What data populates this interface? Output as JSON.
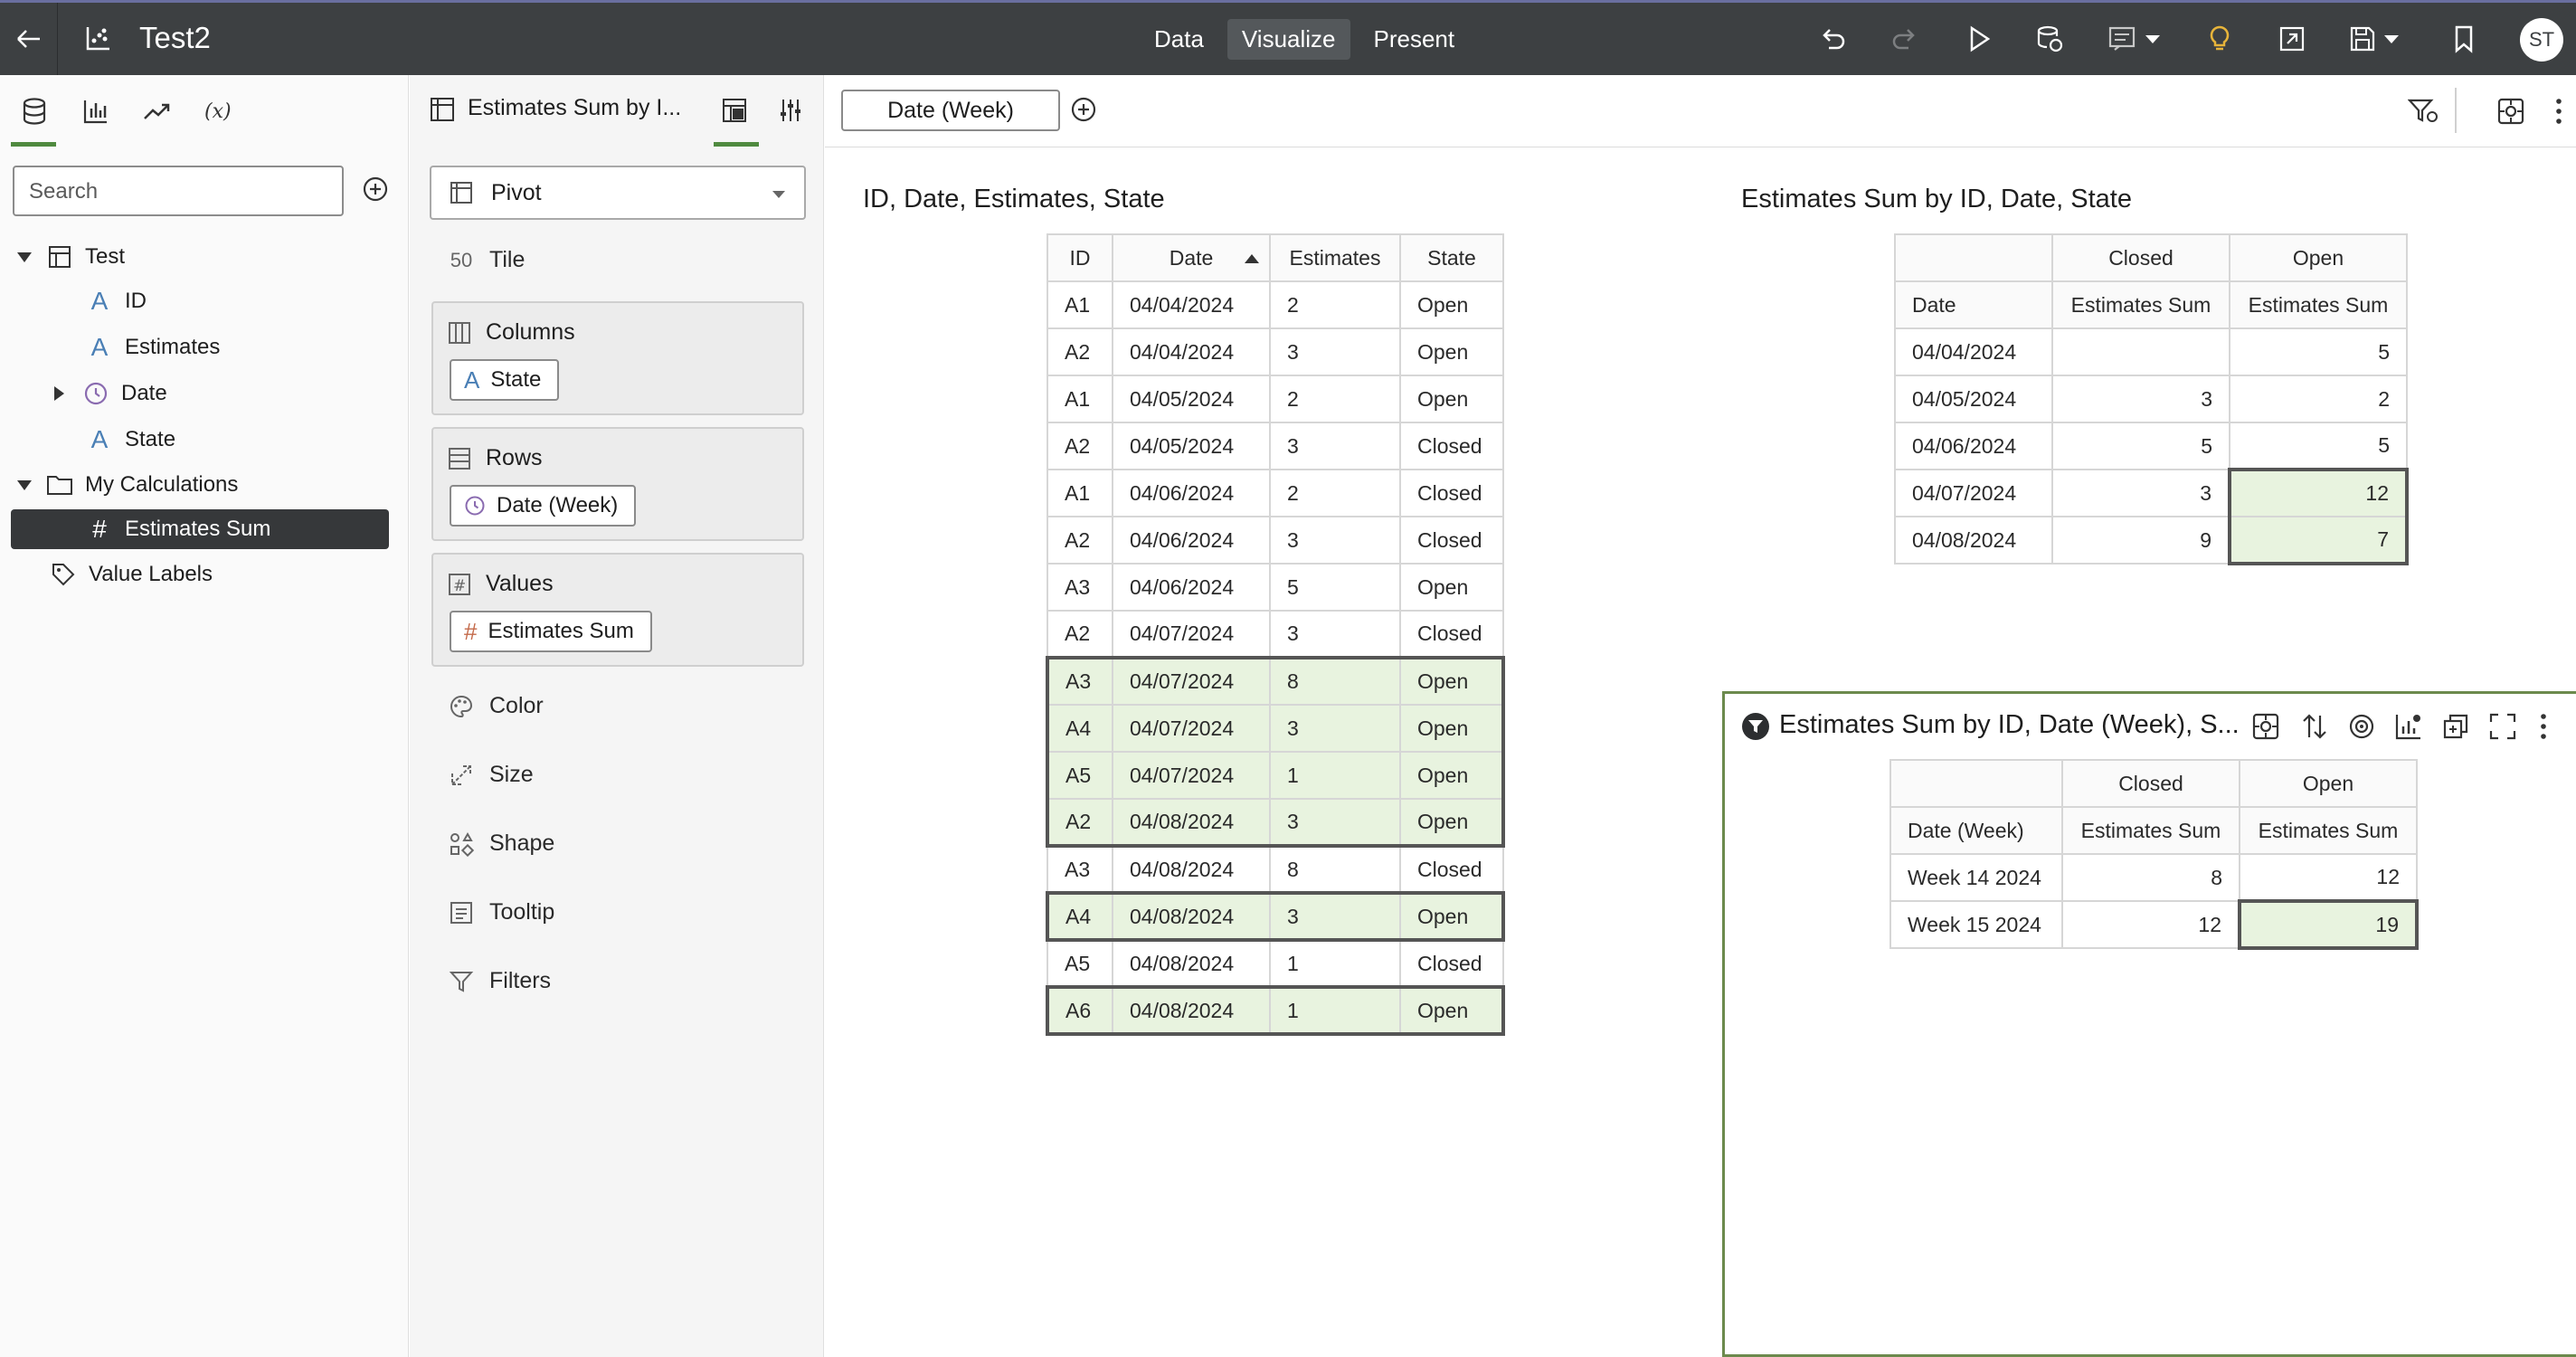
{
  "app": {
    "title": "Test2",
    "mode_tabs": [
      "Data",
      "Visualize",
      "Present"
    ],
    "active_mode": "Visualize",
    "user_initials": "ST",
    "icons": [
      "back-arrow-icon",
      "workbook-icon",
      "undo-icon",
      "redo-icon",
      "run-icon",
      "refresh-data-icon",
      "comment-icon",
      "insights-bulb-icon",
      "export-icon",
      "save-icon",
      "bookmark-icon"
    ]
  },
  "data_panel": {
    "tabs": [
      "data-icon",
      "visualizations-icon",
      "analytics-icon",
      "expression-icon"
    ],
    "search_placeholder": "Search",
    "tree": {
      "dataset": "Test",
      "fields": [
        "ID",
        "Estimates",
        "Date",
        "State"
      ],
      "calculations_folder": "My Calculations",
      "calculation": "Estimates Sum",
      "value_labels": "Value Labels"
    }
  },
  "grammar_panel": {
    "viz_name": "Estimates Sum by I...",
    "viz_type": "Pivot",
    "tile_label": "Tile",
    "columns": {
      "label": "Columns",
      "pill": "State"
    },
    "rows": {
      "label": "Rows",
      "pill": "Date (Week)"
    },
    "values": {
      "label": "Values",
      "pill": "Estimates Sum"
    },
    "properties": [
      "Color",
      "Size",
      "Shape",
      "Tooltip",
      "Filters"
    ]
  },
  "canvas": {
    "filter_chip": "Date (Week)",
    "viz1": {
      "title": "ID, Date, Estimates, State",
      "headers": [
        "ID",
        "Date",
        "Estimates",
        "State"
      ],
      "rows": [
        [
          "A1",
          "04/04/2024",
          "2",
          "Open"
        ],
        [
          "A2",
          "04/04/2024",
          "3",
          "Open"
        ],
        [
          "A1",
          "04/05/2024",
          "2",
          "Open"
        ],
        [
          "A2",
          "04/05/2024",
          "3",
          "Closed"
        ],
        [
          "A1",
          "04/06/2024",
          "2",
          "Closed"
        ],
        [
          "A2",
          "04/06/2024",
          "3",
          "Closed"
        ],
        [
          "A3",
          "04/06/2024",
          "5",
          "Open"
        ],
        [
          "A2",
          "04/07/2024",
          "3",
          "Closed"
        ],
        [
          "A3",
          "04/07/2024",
          "8",
          "Open"
        ],
        [
          "A4",
          "04/07/2024",
          "3",
          "Open"
        ],
        [
          "A5",
          "04/07/2024",
          "1",
          "Open"
        ],
        [
          "A2",
          "04/08/2024",
          "3",
          "Open"
        ],
        [
          "A3",
          "04/08/2024",
          "8",
          "Closed"
        ],
        [
          "A4",
          "04/08/2024",
          "3",
          "Open"
        ],
        [
          "A5",
          "04/08/2024",
          "1",
          "Closed"
        ],
        [
          "A6",
          "04/08/2024",
          "1",
          "Open"
        ]
      ]
    },
    "viz2": {
      "title": "Estimates Sum by ID, Date, State",
      "col_headers": [
        "Closed",
        "Open"
      ],
      "row_header": "Date",
      "measure": "Estimates Sum",
      "rows": [
        [
          "04/04/2024",
          "",
          "5"
        ],
        [
          "04/05/2024",
          "3",
          "2"
        ],
        [
          "04/06/2024",
          "5",
          "5"
        ],
        [
          "04/07/2024",
          "3",
          "12"
        ],
        [
          "04/08/2024",
          "9",
          "7"
        ]
      ]
    },
    "viz3": {
      "title": "Estimates Sum by ID, Date (Week), S...",
      "col_headers": [
        "Closed",
        "Open"
      ],
      "row_header": "Date (Week)",
      "measure": "Estimates Sum",
      "rows": [
        [
          "Week 14 2024",
          "8",
          "12"
        ],
        [
          "Week 15 2024",
          "12",
          "19"
        ]
      ]
    }
  }
}
